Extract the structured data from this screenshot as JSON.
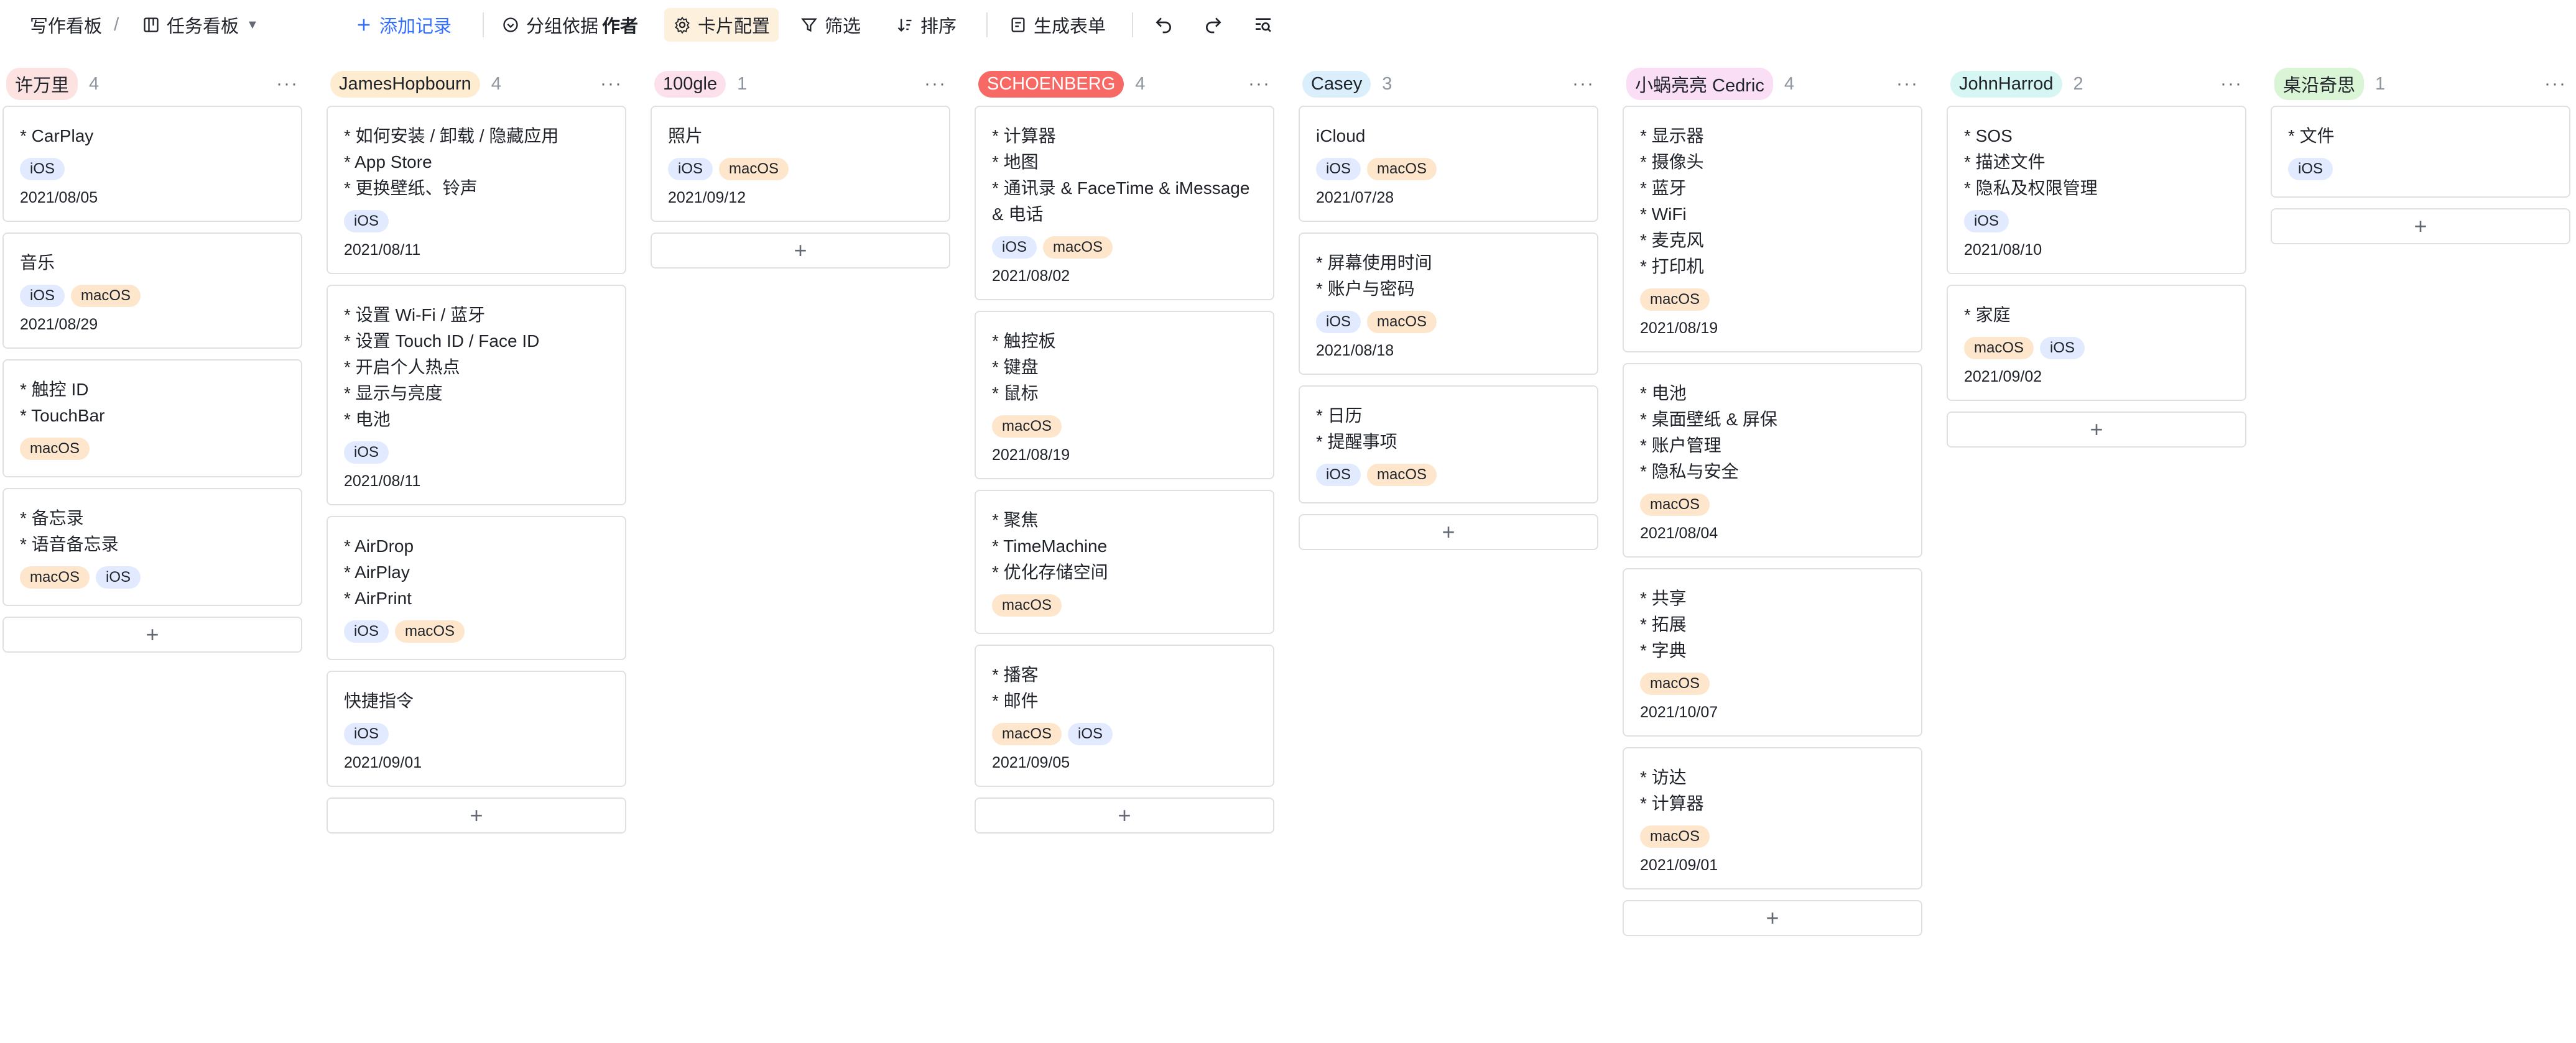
{
  "toolbar": {
    "crumb1": "写作看板",
    "separator": "/",
    "crumb2": "任务看板",
    "add_record": "添加记录",
    "group_by": "分组依据",
    "group_field": "作者",
    "card_config": "卡片配置",
    "filter": "筛选",
    "sort": "排序",
    "gen_form": "生成表单",
    "accent": "#3370ff"
  },
  "columns": [
    {
      "name": "许万里",
      "count": "4",
      "color": "#fde2e2",
      "cards": [
        {
          "lines": [
            "* CarPlay"
          ],
          "tags": [
            "iOS"
          ],
          "date": "2021/08/05"
        },
        {
          "lines": [
            "音乐"
          ],
          "tags": [
            "iOS",
            "macOS"
          ],
          "date": "2021/08/29"
        },
        {
          "lines": [
            "* 触控 ID",
            "* TouchBar"
          ],
          "tags": [
            "macOS"
          ],
          "date": ""
        },
        {
          "lines": [
            "* 备忘录",
            "* 语音备忘录"
          ],
          "tags": [
            "macOS",
            "iOS"
          ],
          "date": ""
        }
      ]
    },
    {
      "name": "JamesHopbourn",
      "count": "4",
      "color": "#fdeccf",
      "cards": [
        {
          "lines": [
            "* 如何安装 / 卸载 / 隐藏应用",
            "* App Store",
            "* 更换壁纸、铃声"
          ],
          "tags": [
            "iOS"
          ],
          "date": "2021/08/11"
        },
        {
          "lines": [
            "* 设置 Wi-Fi / 蓝牙",
            "* 设置 Touch ID / Face ID",
            "* 开启个人热点",
            "* 显示与亮度",
            "* 电池"
          ],
          "tags": [
            "iOS"
          ],
          "date": "2021/08/11"
        },
        {
          "lines": [
            "* AirDrop",
            "* AirPlay",
            "* AirPrint"
          ],
          "tags": [
            "iOS",
            "macOS"
          ],
          "date": ""
        },
        {
          "lines": [
            "快捷指令"
          ],
          "tags": [
            "iOS"
          ],
          "date": "2021/09/01"
        }
      ]
    },
    {
      "name": "100gle",
      "count": "1",
      "color": "#fce0ec",
      "cards": [
        {
          "lines": [
            "照片"
          ],
          "tags": [
            "iOS",
            "macOS"
          ],
          "date": "2021/09/12"
        }
      ]
    },
    {
      "name": "SCHOENBERG",
      "count": "4",
      "color": "#f76964",
      "cards": [
        {
          "lines": [
            "* 计算器",
            "* 地图",
            "* 通讯录 & FaceTime & iMessage",
            "& 电话"
          ],
          "tags": [
            "iOS",
            "macOS"
          ],
          "date": "2021/08/02"
        },
        {
          "lines": [
            "* 触控板",
            "* 键盘",
            "* 鼠标"
          ],
          "tags": [
            "macOS"
          ],
          "date": "2021/08/19"
        },
        {
          "lines": [
            "* 聚焦",
            "* TimeMachine",
            "* 优化存储空间"
          ],
          "tags": [
            "macOS"
          ],
          "date": ""
        },
        {
          "lines": [
            "* 播客",
            "* 邮件"
          ],
          "tags": [
            "macOS",
            "iOS"
          ],
          "date": "2021/09/05"
        }
      ]
    },
    {
      "name": "Casey",
      "count": "3",
      "color": "#dbeefb",
      "cards": [
        {
          "lines": [
            "iCloud"
          ],
          "tags": [
            "iOS",
            "macOS"
          ],
          "date": "2021/07/28"
        },
        {
          "lines": [
            "* 屏幕使用时间",
            "* 账户与密码"
          ],
          "tags": [
            "iOS",
            "macOS"
          ],
          "date": "2021/08/18"
        },
        {
          "lines": [
            "* 日历",
            "* 提醒事项"
          ],
          "tags": [
            "iOS",
            "macOS"
          ],
          "date": ""
        }
      ]
    },
    {
      "name": "小蜗亮亮 Cedric",
      "count": "4",
      "color": "#f9def6",
      "cards": [
        {
          "lines": [
            "* 显示器",
            "* 摄像头",
            "* 蓝牙",
            "* WiFi",
            "* 麦克风",
            "* 打印机"
          ],
          "tags": [
            "macOS"
          ],
          "date": "2021/08/19"
        },
        {
          "lines": [
            "* 电池",
            "* 桌面壁纸 & 屏保",
            "* 账户管理",
            "* 隐私与安全"
          ],
          "tags": [
            "macOS"
          ],
          "date": "2021/08/04"
        },
        {
          "lines": [
            "* 共享",
            "* 拓展",
            "* 字典"
          ],
          "tags": [
            "macOS"
          ],
          "date": "2021/10/07"
        },
        {
          "lines": [
            "* 访达",
            "* 计算器"
          ],
          "tags": [
            "macOS"
          ],
          "date": "2021/09/01"
        }
      ]
    },
    {
      "name": "JohnHarrod",
      "count": "2",
      "color": "#d5f6f2",
      "cards": [
        {
          "lines": [
            "* SOS",
            "* 描述文件",
            "* 隐私及权限管理"
          ],
          "tags": [
            "iOS"
          ],
          "date": "2021/08/10"
        },
        {
          "lines": [
            "* 家庭"
          ],
          "tags": [
            "macOS",
            "iOS"
          ],
          "date": "2021/09/02"
        }
      ]
    },
    {
      "name": "桌沿奇思",
      "count": "1",
      "color": "#d9f5d6",
      "cards": [
        {
          "lines": [
            "* 文件"
          ],
          "tags": [
            "iOS"
          ],
          "date": ""
        }
      ]
    }
  ],
  "ui": {
    "add_symbol": "+",
    "more_symbol": "···"
  }
}
